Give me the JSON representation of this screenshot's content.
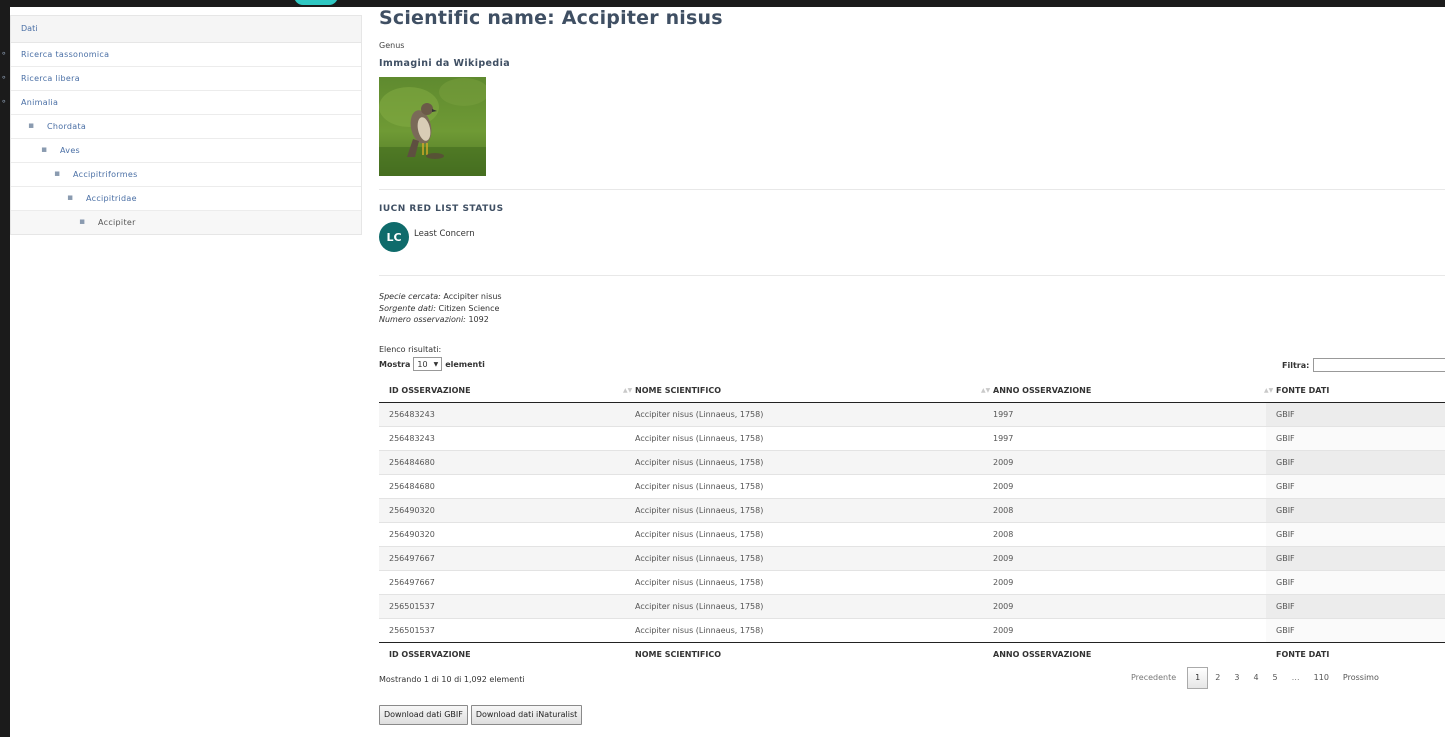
{
  "sidebar": {
    "header": "Dati",
    "items": [
      {
        "label": "Ricerca tassonomica",
        "bullet": "∘"
      },
      {
        "label": "Ricerca libera",
        "bullet": "∘"
      },
      {
        "label": "Animalia",
        "bullet": "∘"
      },
      {
        "label": "Chordata",
        "bullet": "▪"
      },
      {
        "label": "Aves",
        "bullet": "▪"
      },
      {
        "label": "Accipitriformes",
        "bullet": "▪"
      },
      {
        "label": "Accipitridae",
        "bullet": "▪"
      },
      {
        "label": "Accipiter",
        "bullet": "▪"
      }
    ]
  },
  "main": {
    "title": "Scientific name: Accipiter nisus",
    "rank": "Genus",
    "wiki_heading": "Immagini da Wikipedia",
    "iucn": {
      "heading": "IUCN RED LIST STATUS",
      "badge": "LC",
      "status": "Least Concern",
      "color": "#0f6b6b"
    },
    "meta": {
      "species_label": "Specie cercata:",
      "species_value": "Accipiter nisus",
      "source_label": "Sorgente dati:",
      "source_value": "Citizen Science",
      "count_label": "Numero osservazioni:",
      "count_value": "1092"
    },
    "results_label": "Elenco risultati:",
    "show_prefix": "Mostra",
    "show_value": "10",
    "show_suffix": "elementi",
    "filter_label": "Filtra:",
    "filter_value": ""
  },
  "table": {
    "columns": [
      "ID OSSERVAZIONE",
      "NOME SCIENTIFICO",
      "ANNO OSSERVAZIONE",
      "FONTE DATI"
    ],
    "rows": [
      [
        "256483243",
        "Accipiter nisus (Linnaeus, 1758)",
        "1997",
        "GBIF"
      ],
      [
        "256483243",
        "Accipiter nisus (Linnaeus, 1758)",
        "1997",
        "GBIF"
      ],
      [
        "256484680",
        "Accipiter nisus (Linnaeus, 1758)",
        "2009",
        "GBIF"
      ],
      [
        "256484680",
        "Accipiter nisus (Linnaeus, 1758)",
        "2009",
        "GBIF"
      ],
      [
        "256490320",
        "Accipiter nisus (Linnaeus, 1758)",
        "2008",
        "GBIF"
      ],
      [
        "256490320",
        "Accipiter nisus (Linnaeus, 1758)",
        "2008",
        "GBIF"
      ],
      [
        "256497667",
        "Accipiter nisus (Linnaeus, 1758)",
        "2009",
        "GBIF"
      ],
      [
        "256497667",
        "Accipiter nisus (Linnaeus, 1758)",
        "2009",
        "GBIF"
      ],
      [
        "256501537",
        "Accipiter nisus (Linnaeus, 1758)",
        "2009",
        "GBIF"
      ],
      [
        "256501537",
        "Accipiter nisus (Linnaeus, 1758)",
        "2009",
        "GBIF"
      ]
    ],
    "showing": "Mostrando 1 di 10 di 1,092 elementi"
  },
  "pagination": {
    "prev": "Precedente",
    "pages": [
      "1",
      "2",
      "3",
      "4",
      "5",
      "…",
      "110"
    ],
    "current": "1",
    "next": "Prossimo"
  },
  "downloads": {
    "gbif": "Download dati GBIF",
    "inat": "Download dati iNaturalist"
  }
}
